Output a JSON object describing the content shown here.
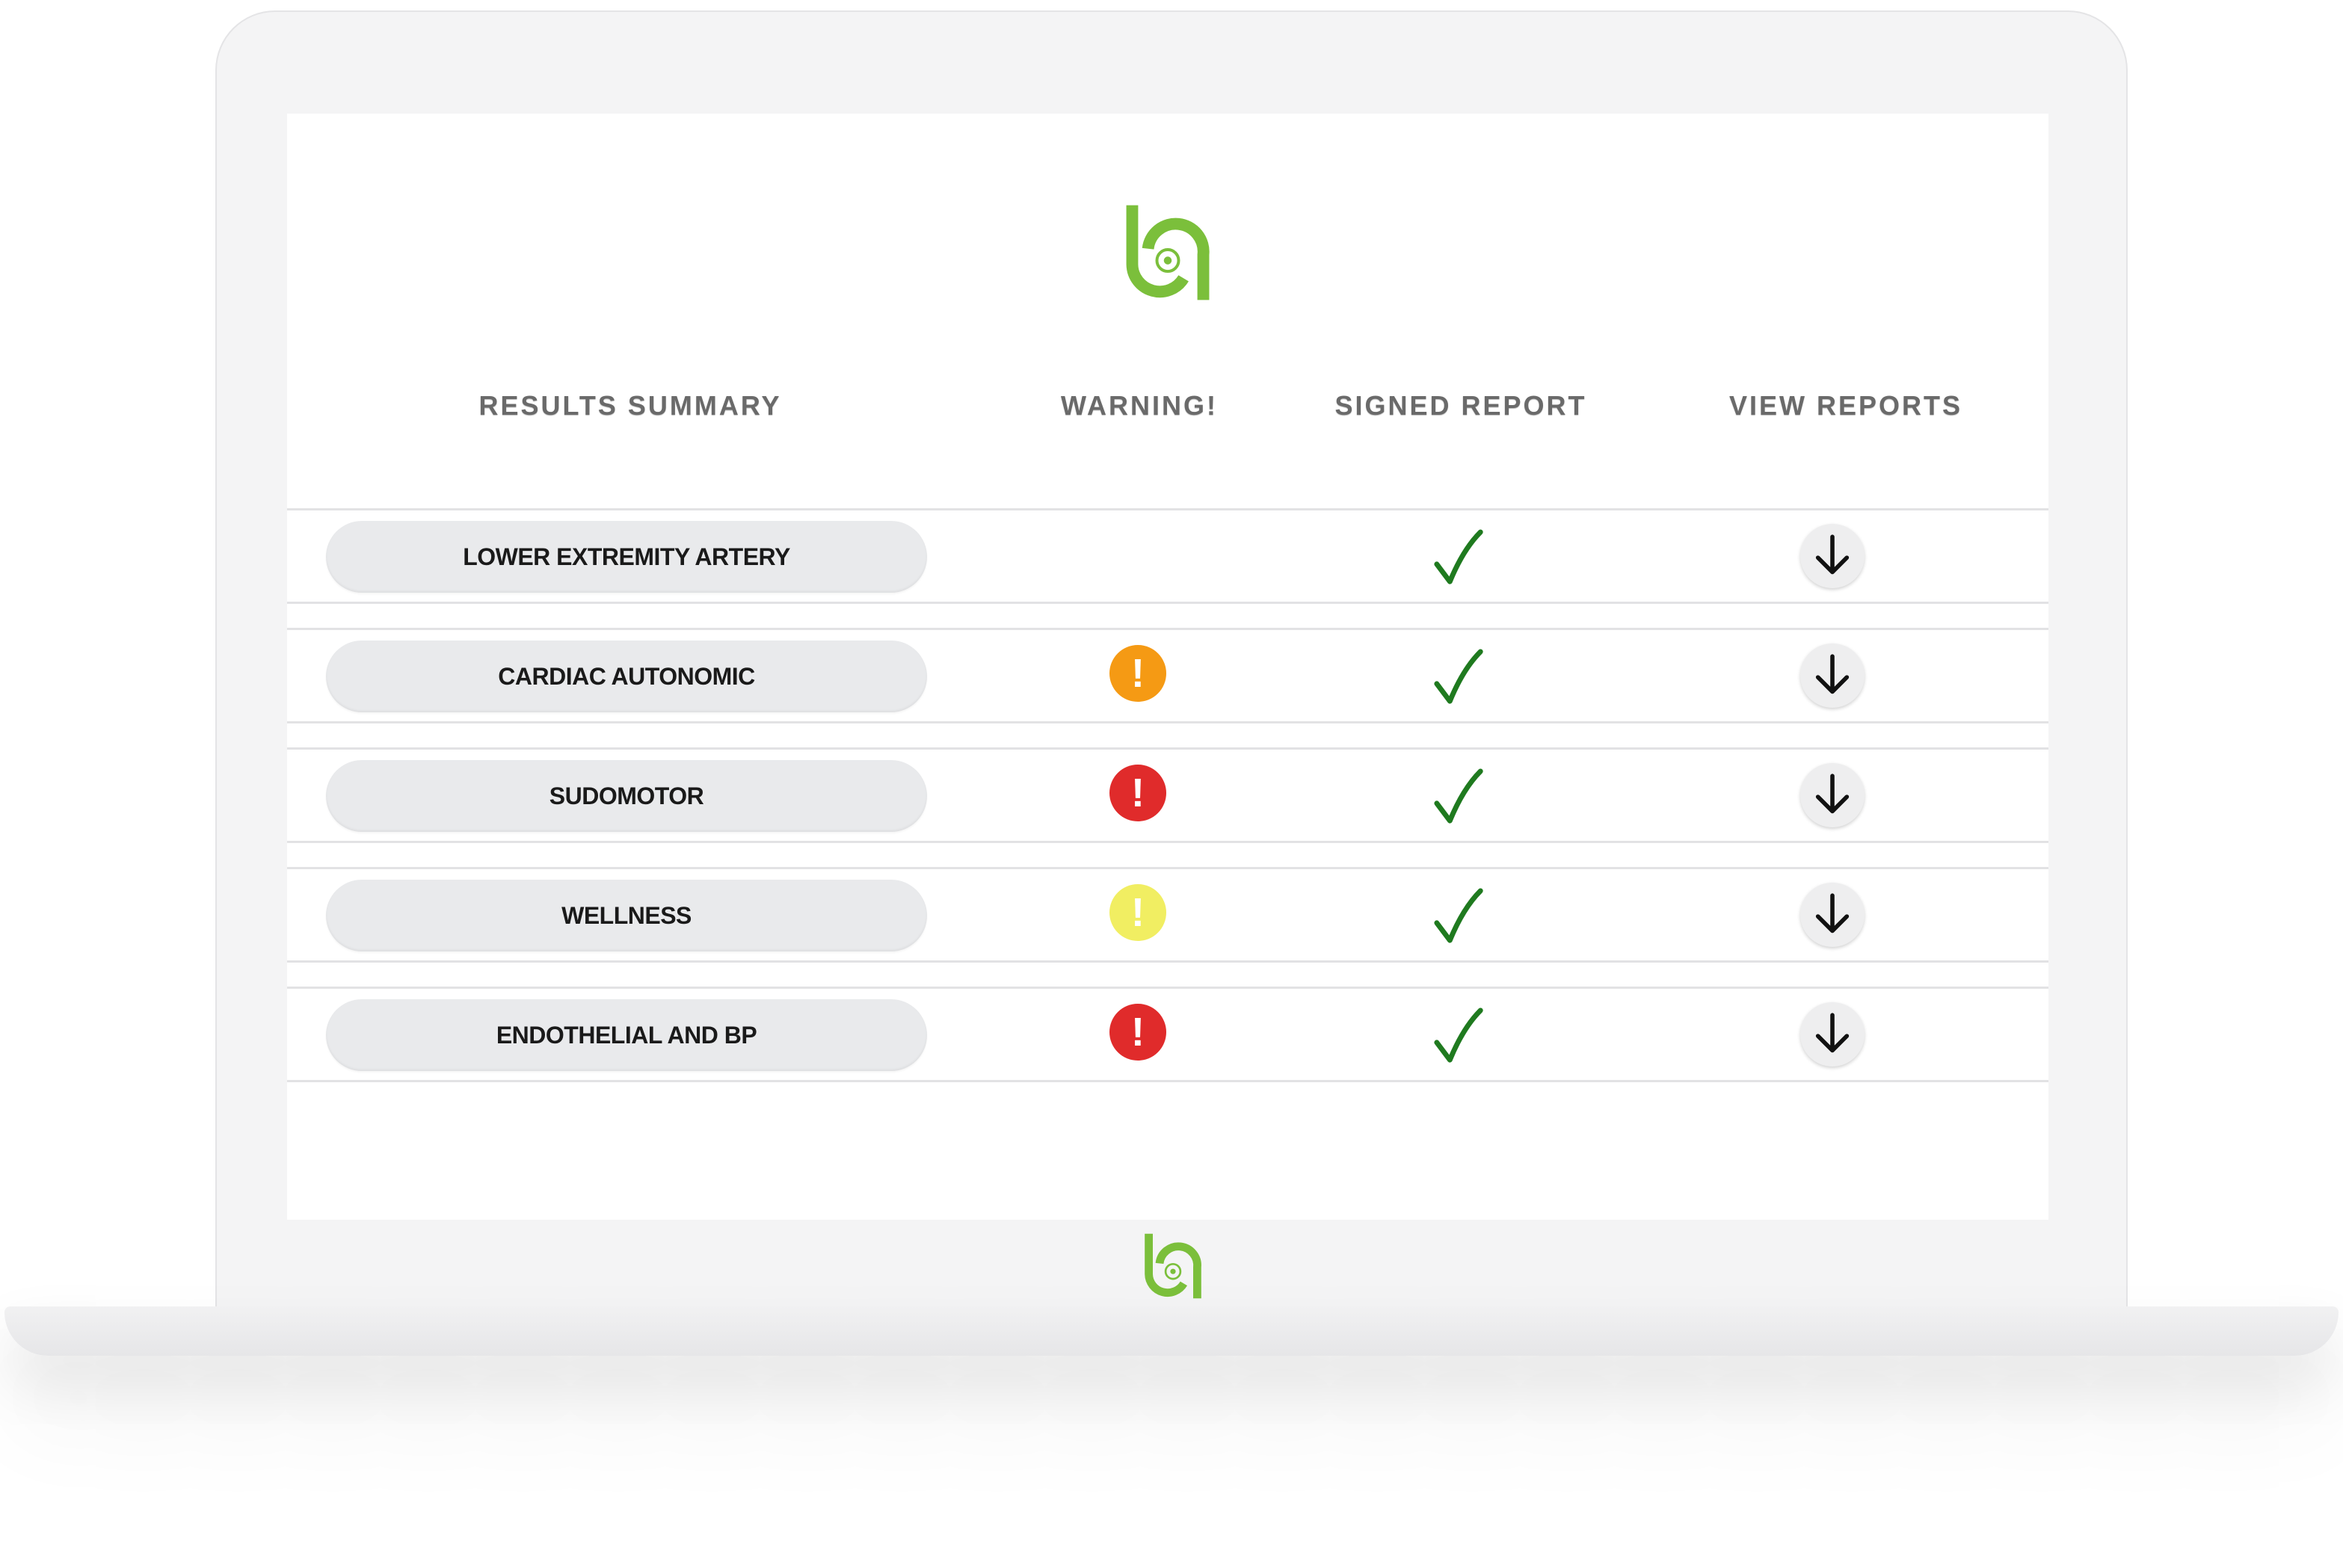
{
  "colors": {
    "brand_green": "#7bbf3b",
    "check_green": "#1f7a1f",
    "warning_orange": "#f59a14",
    "warning_red": "#e02b2b",
    "warning_yellow": "#f1ee62"
  },
  "logo": {
    "icon": "brand-logo-icon"
  },
  "table": {
    "headers": {
      "results_summary": "RESULTS SUMMARY",
      "warning": "WARNING!",
      "signed_report": "SIGNED REPORT",
      "view_reports": "VIEW REPORTS"
    },
    "rows": [
      {
        "label": "LOWER EXTREMITY ARTERY",
        "warning": null,
        "signed": true,
        "download_icon": "arrow-down-icon"
      },
      {
        "label": "CARDIAC AUTONOMIC",
        "warning": "orange",
        "warning_glyph": "!",
        "signed": true,
        "download_icon": "arrow-down-icon"
      },
      {
        "label": "SUDOMOTOR",
        "warning": "red",
        "warning_glyph": "!",
        "signed": true,
        "download_icon": "arrow-down-icon"
      },
      {
        "label": "WELLNESS",
        "warning": "yellow",
        "warning_glyph": "!",
        "signed": true,
        "download_icon": "arrow-down-icon"
      },
      {
        "label": "ENDOTHELIAL AND BP",
        "warning": "red",
        "warning_glyph": "!",
        "signed": true,
        "download_icon": "arrow-down-icon"
      }
    ]
  }
}
